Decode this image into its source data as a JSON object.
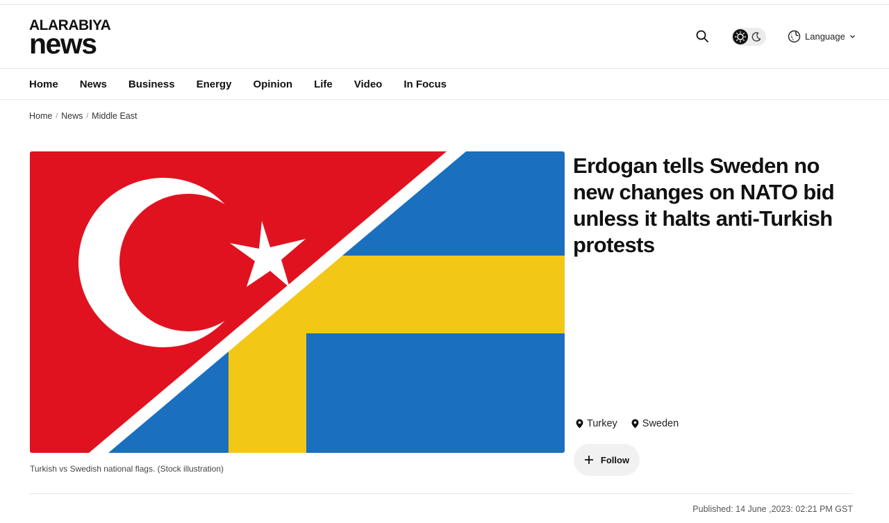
{
  "header": {
    "logo_top": "ALARABIYA",
    "logo_bottom": "news",
    "search_icon": "search-icon",
    "theme_icons": [
      "sun-icon",
      "moon-icon"
    ],
    "language_label": "Language",
    "language_icon": "globe-icon"
  },
  "nav": {
    "items": [
      {
        "label": "Home"
      },
      {
        "label": "News"
      },
      {
        "label": "Business"
      },
      {
        "label": "Energy"
      },
      {
        "label": "Opinion"
      },
      {
        "label": "Life"
      },
      {
        "label": "Video"
      },
      {
        "label": "In Focus"
      }
    ]
  },
  "breadcrumb": {
    "items": [
      "Home",
      "News",
      "Middle East"
    ],
    "separator": "/"
  },
  "article": {
    "headline": "Erdogan tells Sweden no new changes on NATO bid unless it halts anti-Turkish protests",
    "image_caption": "Turkish vs Swedish national flags. (Stock illustration)",
    "tags": [
      "Turkey",
      "Sweden"
    ],
    "follow_label": "Follow",
    "published": "Published: 14 June ,2023: 02:21 PM GST"
  },
  "colors": {
    "turkey_red": "#e1121f",
    "sweden_blue": "#1a6fbf",
    "sweden_yellow": "#f3c716",
    "accent": "#0c6b5e"
  }
}
